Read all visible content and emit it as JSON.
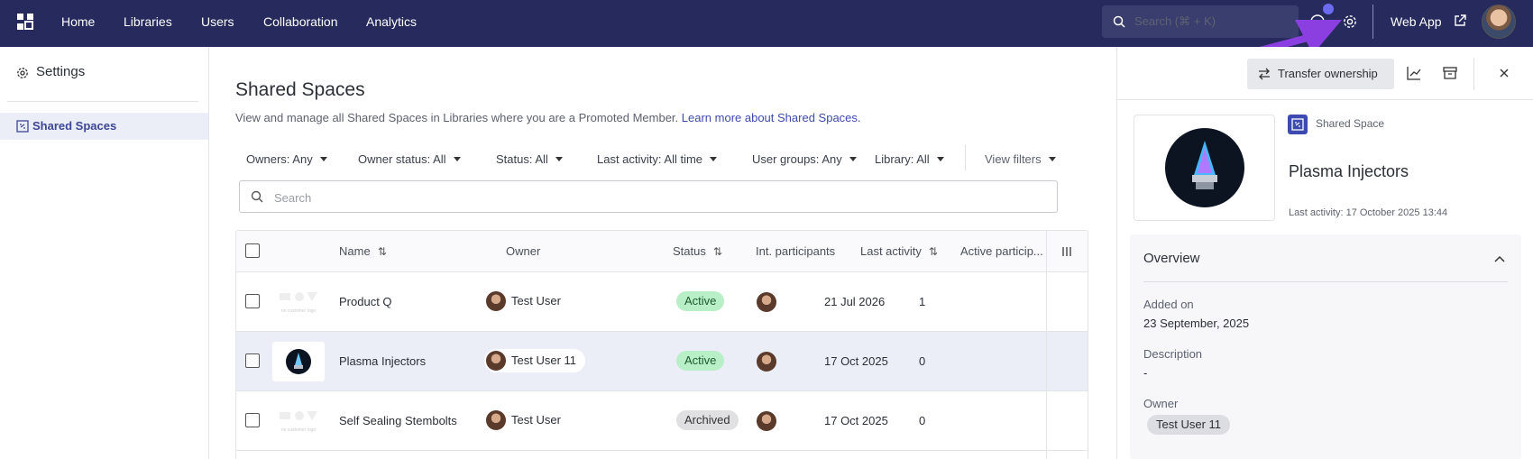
{
  "topbar": {
    "nav": [
      "Home",
      "Libraries",
      "Users",
      "Collaboration",
      "Analytics"
    ],
    "search_label": "Search (⌘ + K)",
    "web_app": "Web App"
  },
  "sidebar": {
    "title": "Settings",
    "items": [
      {
        "label": "Shared Spaces",
        "active": true
      }
    ]
  },
  "main": {
    "title": "Shared Spaces",
    "description": "View and manage all Shared Spaces in Libraries where you are a Promoted Member.",
    "learn_more": "Learn more about Shared Spaces.",
    "filters": [
      "Owners: Any",
      "Owner status: All",
      "Status: All",
      "Last activity: All time",
      "User groups: Any",
      "Library: All",
      "View filters"
    ],
    "search_placeholder": "Search",
    "columns": [
      "Name",
      "Owner",
      "Status",
      "Int. participants",
      "Last activity",
      "Active particip..."
    ],
    "rows": [
      {
        "name": "Product Q",
        "owner": "Test User",
        "status": "Active",
        "last_activity": "21 Jul 2026",
        "active": "1",
        "thumb_text": "no customer logo"
      },
      {
        "name": "Plasma Injectors",
        "owner": "Test User 11",
        "status": "Active",
        "last_activity": "17 Oct 2025",
        "active": "0",
        "selected": true
      },
      {
        "name": "Self Sealing Stembolts",
        "owner": "Test User",
        "status": "Archived",
        "last_activity": "17 Oct 2025",
        "active": "0",
        "thumb_text": "no customer logo"
      }
    ]
  },
  "panel": {
    "transfer": "Transfer ownership",
    "type_label": "Shared Space",
    "title": "Plasma Injectors",
    "last_activity": "Last activity: 17 October 2025 13:44",
    "overview_title": "Overview",
    "added_label": "Added on",
    "added_value": "23 September, 2025",
    "desc_label": "Description",
    "desc_value": "-",
    "owner_label": "Owner",
    "owner_value": "Test User 11"
  },
  "colors": {
    "topbar": "#262a5c",
    "accent": "#3d4ab0",
    "arrow": "#8b3fe0",
    "active_badge": "#b9efc6"
  }
}
